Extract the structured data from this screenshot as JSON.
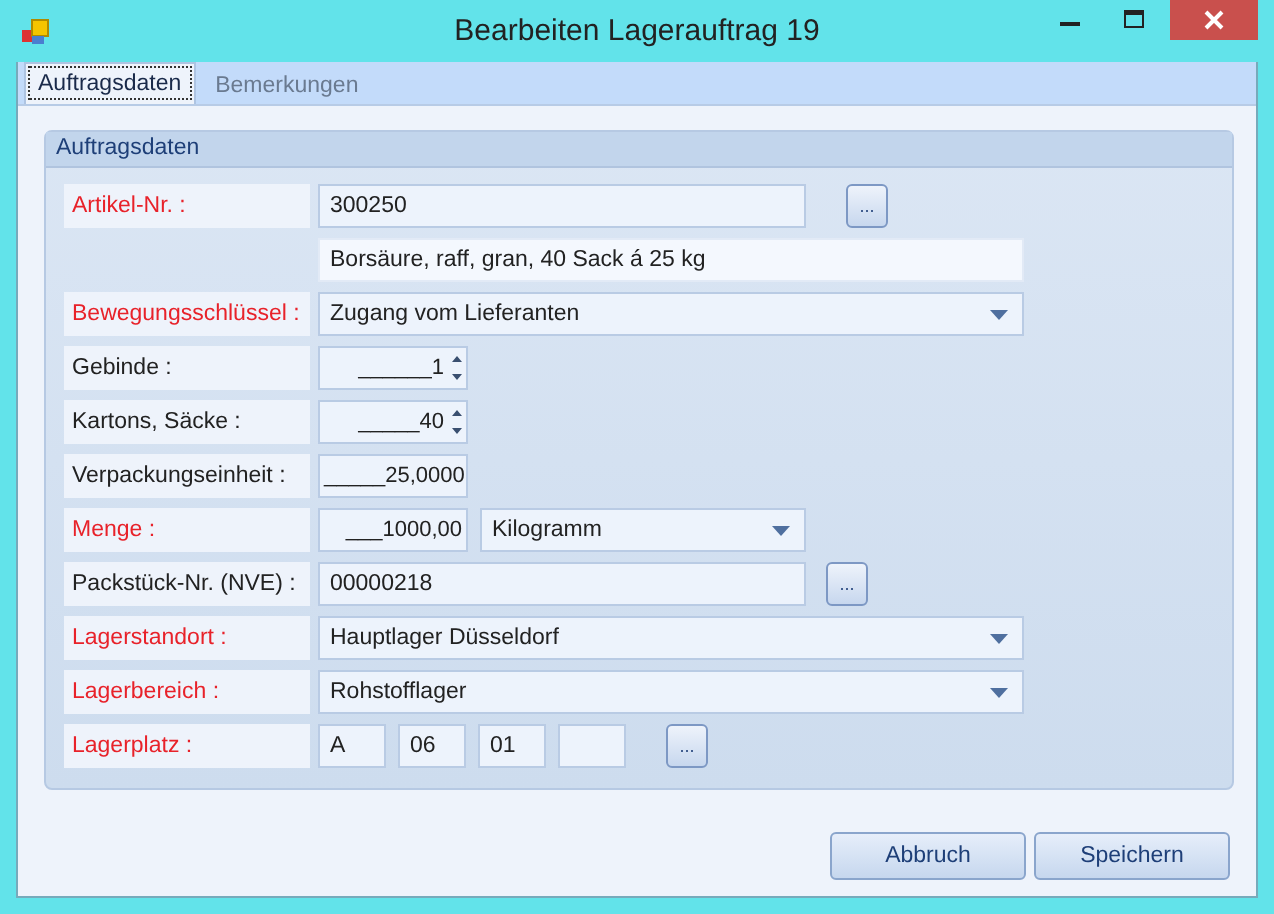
{
  "window": {
    "title": "Bearbeiten Lagerauftrag 19"
  },
  "tabs": [
    {
      "label": "Auftragsdaten",
      "selected": true
    },
    {
      "label": "Bemerkungen",
      "selected": false
    }
  ],
  "group": {
    "title": "Auftragsdaten",
    "rows": [
      {
        "kind": "text",
        "label": "Artikel-Nr. :",
        "required": true,
        "value": "300250",
        "button": "..."
      },
      {
        "kind": "info",
        "value": "Borsäure, raff, gran, 40 Sack á 25 kg"
      },
      {
        "kind": "combo",
        "label": "Bewegungsschlüssel :",
        "required": true,
        "value": "Zugang vom Lieferanten"
      },
      {
        "kind": "spin",
        "label": "Gebinde :",
        "required": false,
        "value": "______1"
      },
      {
        "kind": "spin",
        "label": "Kartons, Säcke :",
        "required": false,
        "value": "_____40"
      },
      {
        "kind": "number",
        "label": "Verpackungseinheit :",
        "required": false,
        "value": "_____25,0000"
      },
      {
        "kind": "quantity",
        "label": "Menge :",
        "required": true,
        "value": "___1000,00",
        "unit": "Kilogramm"
      },
      {
        "kind": "text",
        "label": "Packstück-Nr. (NVE) :",
        "required": false,
        "value": "00000218",
        "button": "..."
      },
      {
        "kind": "combo",
        "label": "Lagerstandort :",
        "required": true,
        "value": "Hauptlager Düsseldorf"
      },
      {
        "kind": "combo",
        "label": "Lagerbereich :",
        "required": true,
        "value": "Rohstofflager"
      },
      {
        "kind": "location",
        "label": "Lagerplatz :",
        "required": true,
        "values": [
          "A",
          "06",
          "01"
        ],
        "button": "..."
      }
    ]
  },
  "buttons": [
    "Abbruch",
    "Speichern"
  ]
}
